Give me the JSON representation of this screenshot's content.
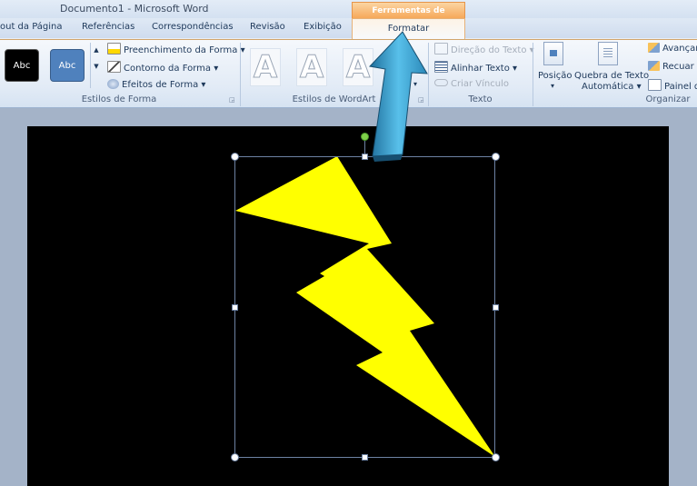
{
  "title_bar": {
    "document_title": "Documento1 -  Microsoft Word"
  },
  "tabs": [
    "out da Página",
    "Referências",
    "Correspondências",
    "Revisão",
    "Exibição"
  ],
  "contextual": {
    "header": "Ferramentas de Desenho",
    "active_tab": "Formatar",
    "color": "#f6a85a"
  },
  "ribbon": {
    "shape_styles": {
      "swatch1": "Abc",
      "swatch2": "Abc",
      "fill": "Preenchimento da Forma",
      "outline": "Contorno da Forma",
      "effects": "Efeitos de Forma",
      "label": "Estilos de Forma"
    },
    "wordart": {
      "glyph": "A",
      "label": "Estilos de WordArt"
    },
    "text": {
      "direction": "Direção do Texto",
      "align": "Alinhar Texto",
      "link": "Criar Vínculo",
      "label": "Texto"
    },
    "arrange": {
      "position": "Posição",
      "wrap_line1": "Quebra de Texto",
      "wrap_line2": "Automática",
      "bring_forward": "Avançar",
      "send_backward": "Recuar",
      "pane": "Painel d",
      "label": "Organizar"
    }
  },
  "canvas": {
    "background": "#000000",
    "shape": "lightning-bolt",
    "shape_color": "#ffff00"
  },
  "colors": {
    "arrow": "#3fa7d6",
    "accent": "#f6a85a"
  }
}
